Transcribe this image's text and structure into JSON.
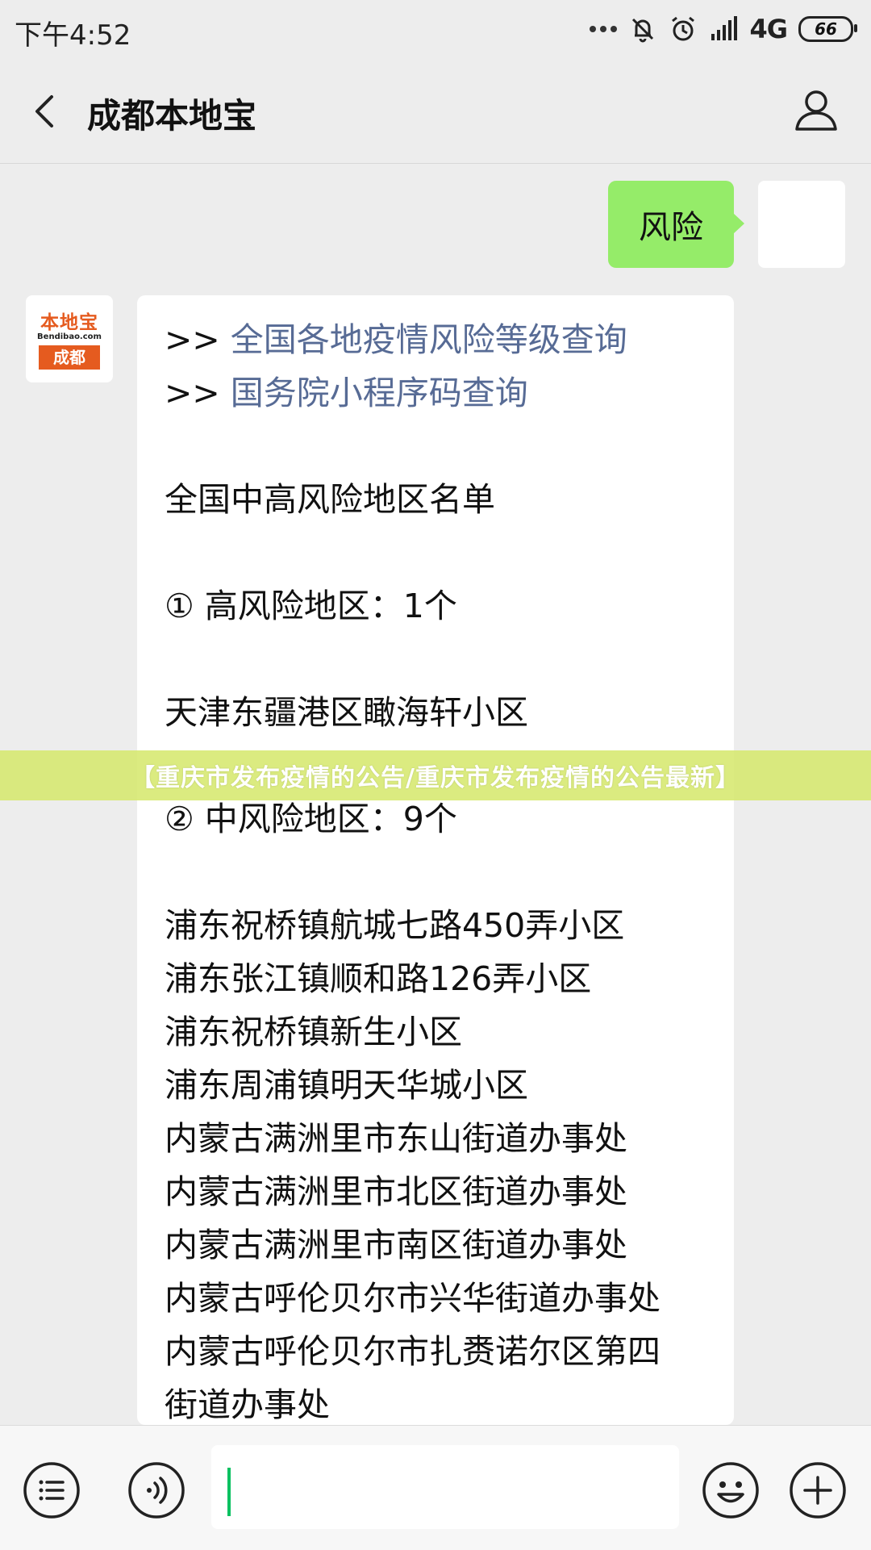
{
  "status_bar": {
    "time": "下午4:52",
    "network": "4G",
    "battery": "66"
  },
  "header": {
    "title": "成都本地宝"
  },
  "messages": {
    "user": {
      "text": "风险"
    },
    "bot_avatar": {
      "name": "本地宝",
      "site": "Bendibao.com",
      "city": "成都"
    },
    "bot": {
      "link1_prefix": ">> ",
      "link1": "全国各地疫情风险等级查询",
      "link2_prefix": ">> ",
      "link2": "国务院小程序码查询",
      "heading": "全国中高风险地区名单",
      "high_title": "① 高风险地区：1个",
      "high_areas": [
        "天津东疆港区瞰海轩小区"
      ],
      "mid_title": "② 中风险地区：9个",
      "mid_areas": [
        "浦东祝桥镇航城七路450弄小区",
        "浦东张江镇顺和路126弄小区",
        "浦东祝桥镇新生小区",
        "浦东周浦镇明天华城小区",
        "内蒙古满洲里市东山街道办事处",
        "内蒙古满洲里市北区街道办事处",
        "内蒙古满洲里市南区街道办事处",
        "内蒙古呼伦贝尔市兴华街道办事处",
        "内蒙古呼伦贝尔市扎赉诺尔区第四",
        "街道办事处"
      ]
    }
  },
  "banner": {
    "text": "【重庆市发布疫情的公告/重庆市发布疫情的公告最新】"
  },
  "input": {
    "value": ""
  },
  "colors": {
    "user_bubble": "#95ec69",
    "link": "#576b95",
    "brand": "#e55b1f",
    "caret": "#07c160"
  }
}
